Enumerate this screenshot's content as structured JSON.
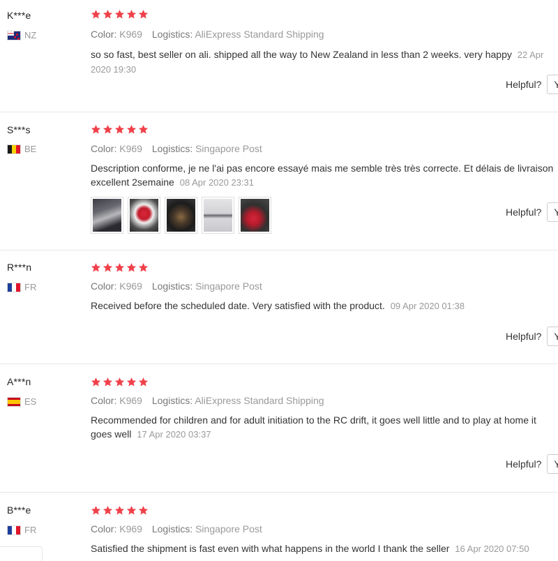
{
  "labels": {
    "color": "Color:",
    "logistics": "Logistics:",
    "helpful": "Helpful?",
    "yes": "Yes"
  },
  "star_color": "#f0414a",
  "reviews": [
    {
      "user": "K***e",
      "country": "NZ",
      "flag": "new-zealand-flag-icon",
      "rating": 5,
      "color": "K969",
      "logistics": "AliExpress Standard Shipping",
      "text": "so so fast, best seller on ali. shipped all the way to New Zealand in less than 2 weeks. very happy",
      "date": "22 Apr 2020 19:30",
      "photos": []
    },
    {
      "user": "S***s",
      "country": "BE",
      "flag": "belgium-flag-icon",
      "rating": 5,
      "color": "K969",
      "logistics": "Singapore Post",
      "text": "Description conforme, je ne l'ai pas encore essayé mais me semble très très correcte. Et délais de livraison excellent 2semaine",
      "date": "08 Apr 2020 23:31",
      "photos": [
        "rc-car-box-photo",
        "rc-car-red-photo",
        "rc-car-chassis-photo",
        "rc-car-manual-photo",
        "rc-car-remote-photo"
      ]
    },
    {
      "user": "R***n",
      "country": "FR",
      "flag": "france-flag-icon",
      "rating": 5,
      "color": "K969",
      "logistics": "Singapore Post",
      "text": "Received before the scheduled date. Very satisfied with the product.",
      "date": "09 Apr 2020 01:38",
      "photos": []
    },
    {
      "user": "A***n",
      "country": "ES",
      "flag": "spain-flag-icon",
      "rating": 5,
      "color": "K969",
      "logistics": "AliExpress Standard Shipping",
      "text": "Recommended for children and for adult initiation to the RC drift, it goes well little and to play at home it goes well",
      "date": "17 Apr 2020 03:37",
      "photos": []
    },
    {
      "user": "B***e",
      "country": "FR",
      "flag": "france-flag-icon",
      "rating": 5,
      "color": "K969",
      "logistics": "Singapore Post",
      "text": "Satisfied the shipment is fast even with what happens in the world I thank the seller",
      "date": "16 Apr 2020 07:50",
      "photos": []
    }
  ]
}
